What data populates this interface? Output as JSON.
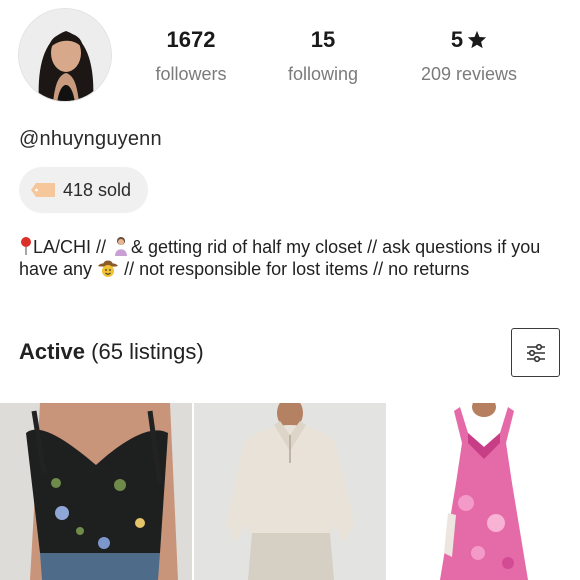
{
  "profile": {
    "username": "@nhuynguyenn",
    "avatar_icon": "profile-photo",
    "stats": {
      "followers": {
        "value": "1672",
        "label": "followers"
      },
      "following": {
        "value": "15",
        "label": "following"
      },
      "rating": {
        "value": "5",
        "label": "209 reviews",
        "icon": "star-icon"
      }
    },
    "sold": {
      "label": "418 sold",
      "icon": "price-tag-icon"
    },
    "bio": {
      "part1": "LA/CHI // ",
      "part2": "& getting rid of half my closet // ask questions if you have any ",
      "part3": " // not responsible for lost items // no returns",
      "icons": [
        "round-pushpin-icon",
        "person-icon",
        "cowboy-face-icon"
      ]
    }
  },
  "listings_section": {
    "title_bold": "Active",
    "title_rest": " (65 listings)",
    "filter_icon": "sliders-icon"
  },
  "listings": [
    {
      "name": "black floral corset top"
    },
    {
      "name": "cream half-zip pullover"
    },
    {
      "name": "pink floral maxi dress"
    }
  ],
  "colors": {
    "text": "#1a1a1a",
    "muted": "#7b7b7b",
    "pill_bg": "#f0f0f0",
    "accent_pin": "#d9302a"
  }
}
